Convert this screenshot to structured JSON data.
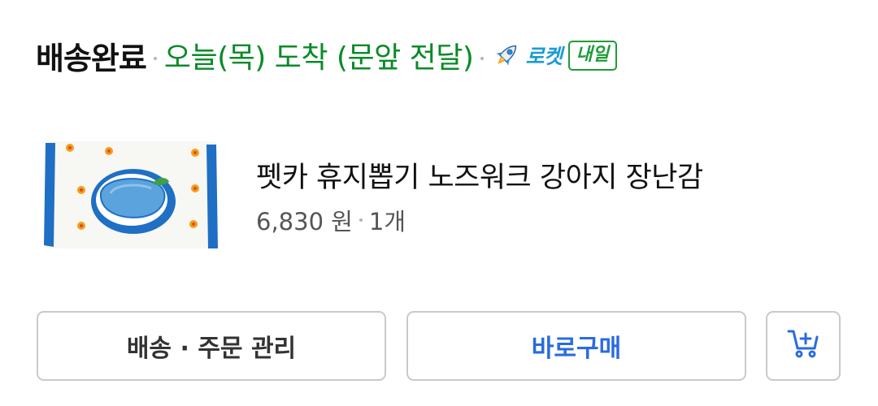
{
  "status": {
    "title": "배송완료",
    "arrival": "오늘(목) 도착 (문앞 전달)",
    "rocket_label": "로켓",
    "tomorrow_badge": "내일",
    "icons": {
      "rocket": "rocket-icon"
    }
  },
  "product": {
    "name": "펫카 휴지뽑기 노즈워크 강아지 장난감",
    "price": "6,830 원",
    "quantity": "1개",
    "image": "product-thumbnail"
  },
  "actions": {
    "manage_label": "배송 · 주문 관리",
    "buy_label": "바로구매",
    "cart_icon": "cart-add-icon"
  },
  "colors": {
    "arrival_green": "#0a8a28",
    "rocket_blue": "#1d9bd7",
    "badge_green": "#1f9c3a",
    "buy_blue": "#2a6be0",
    "border_gray": "#c9c9c9"
  }
}
